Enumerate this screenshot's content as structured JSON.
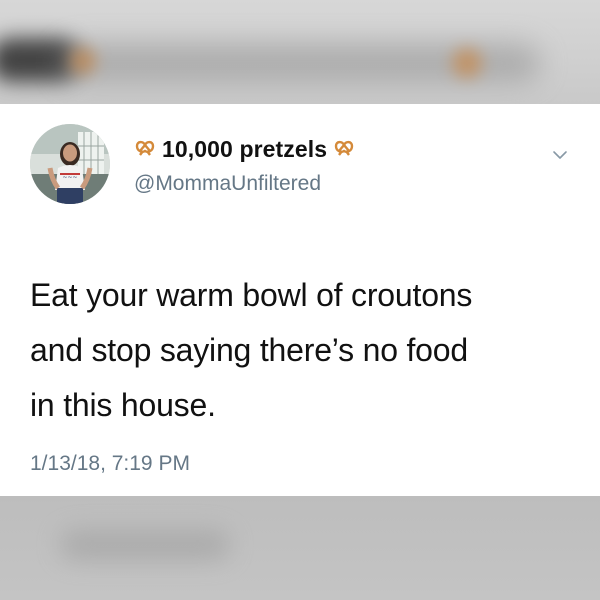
{
  "tweet": {
    "display_name": "10,000 pretzels",
    "handle": "@MommaUnfiltered",
    "text_lines": [
      "Eat your warm bowl of croutons",
      "and stop saying there’s no food",
      "in this house."
    ],
    "timestamp": "1/13/18, 7:19 PM",
    "icons": {
      "name_prefix": "pretzel-icon",
      "name_suffix": "pretzel-icon",
      "menu": "chevron-down-icon"
    }
  },
  "colors": {
    "text": "#111111",
    "secondary": "#657786",
    "pretzel": "#d48a3a",
    "background": "#ffffff"
  }
}
